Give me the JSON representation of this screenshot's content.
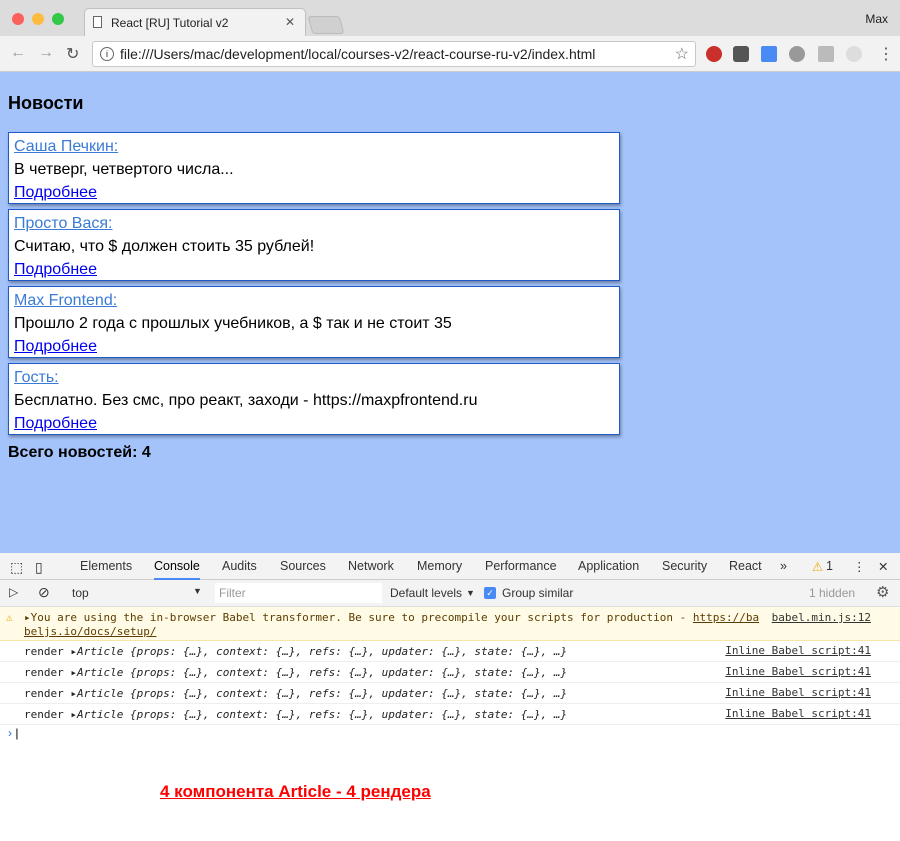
{
  "browser": {
    "tab_title": "React [RU] Tutorial v2",
    "user": "Max",
    "url": "file:///Users/mac/development/local/courses-v2/react-course-ru-v2/index.html"
  },
  "page": {
    "heading": "Новости",
    "articles": [
      {
        "author": "Саша Печкин:",
        "text": "В четверг, четвертого числа...",
        "more": "Подробнее"
      },
      {
        "author": "Просто Вася:",
        "text": "Считаю, что $ должен стоить 35 рублей!",
        "more": "Подробнее"
      },
      {
        "author": "Max Frontend:",
        "text": "Прошло 2 года с прошлых учебников, а $ так и не стоит 35",
        "more": "Подробнее"
      },
      {
        "author": "Гость:",
        "text": "Бесплатно. Без смс, про реакт, заходи - https://maxpfrontend.ru",
        "more": "Подробнее"
      }
    ],
    "count": "Всего новостей: 4"
  },
  "devtools": {
    "tabs": [
      "Elements",
      "Console",
      "Audits",
      "Sources",
      "Network",
      "Memory",
      "Performance",
      "Application",
      "Security",
      "React"
    ],
    "active_tab": "Console",
    "warning_count": "1",
    "context": "top",
    "filter_placeholder": "Filter",
    "levels": "Default levels",
    "group_similar": "Group similar",
    "hidden": "1 hidden",
    "warning": {
      "text": "You are using the in-browser Babel transformer. Be sure to precompile your scripts for production - ",
      "link1": "https://ba",
      "link2": "beljs.io/docs/setup/",
      "source": "babel.min.js:12"
    },
    "logs": [
      {
        "label": "render",
        "obj": "Article {props: {…}, context: {…}, refs: {…}, updater: {…}, state: {…}, …}",
        "source": "Inline Babel script:41"
      },
      {
        "label": "render",
        "obj": "Article {props: {…}, context: {…}, refs: {…}, updater: {…}, state: {…}, …}",
        "source": "Inline Babel script:41"
      },
      {
        "label": "render",
        "obj": "Article {props: {…}, context: {…}, refs: {…}, updater: {…}, state: {…}, …}",
        "source": "Inline Babel script:41"
      },
      {
        "label": "render",
        "obj": "Article {props: {…}, context: {…}, refs: {…}, updater: {…}, state: {…}, …}",
        "source": "Inline Babel script:41"
      }
    ]
  },
  "annotation": "4 компонента Article - 4 рендера"
}
